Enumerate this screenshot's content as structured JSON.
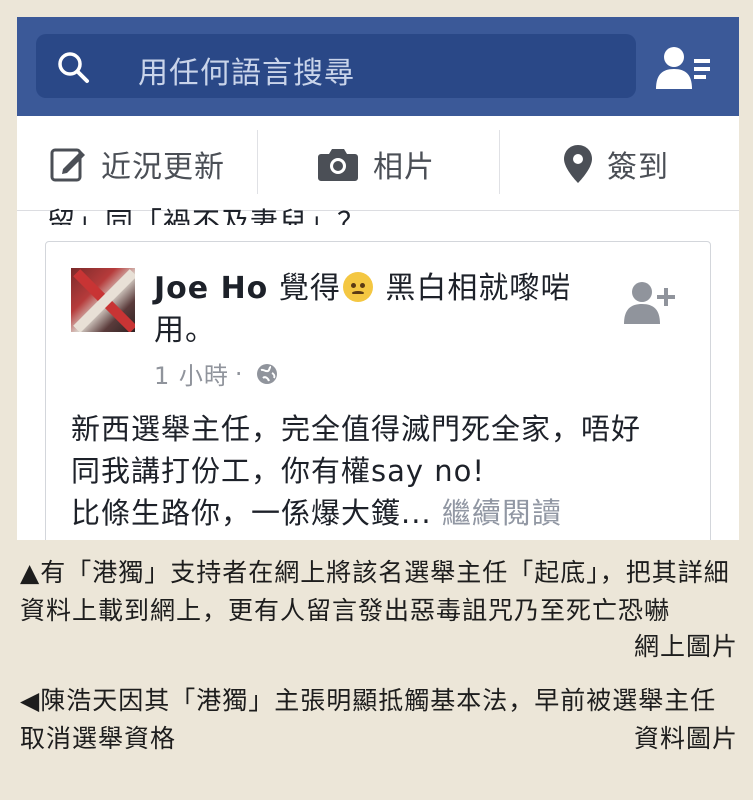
{
  "app": {
    "search": {
      "placeholder": "用任何語言搜尋",
      "icon": "search-icon"
    },
    "friends_icon": "friend-requests-icon",
    "brand_color": "#3b5998"
  },
  "composer": {
    "items": [
      {
        "label": "近況更新",
        "icon": "edit-icon"
      },
      {
        "label": "相片",
        "icon": "camera-icon"
      },
      {
        "label": "簽到",
        "icon": "location-pin-icon"
      }
    ]
  },
  "feed": {
    "cut_text": "留」同「禍不及妻兒」？",
    "post": {
      "author": "Joe Ho",
      "action_before": " 覺得",
      "action_after": " 黑白相就嚟啱用。",
      "emoji": "angry-face-icon",
      "time": "1 小時",
      "separator": "·",
      "privacy_icon": "globe-icon",
      "body_line1": "新西選舉主任，完全值得滅門死全家，唔好",
      "body_line2": "同我講打份工，你有權say no!",
      "body_line3": "比條生路你，一係爆大鑊...",
      "more_label": "繼續閱讀"
    }
  },
  "captions": {
    "caption1": "▲有「港獨」支持者在網上將該名選舉主任「起底」，把其詳細資料上載到網上，更有人留言發出惡毒詛咒乃至死亡恐嚇",
    "credit1": "網上圖片",
    "caption2": "◀陳浩天因其「港獨」主張明顯抵觸基本法，早前被選舉主任取消選舉資格",
    "credit2": "資料圖片"
  }
}
